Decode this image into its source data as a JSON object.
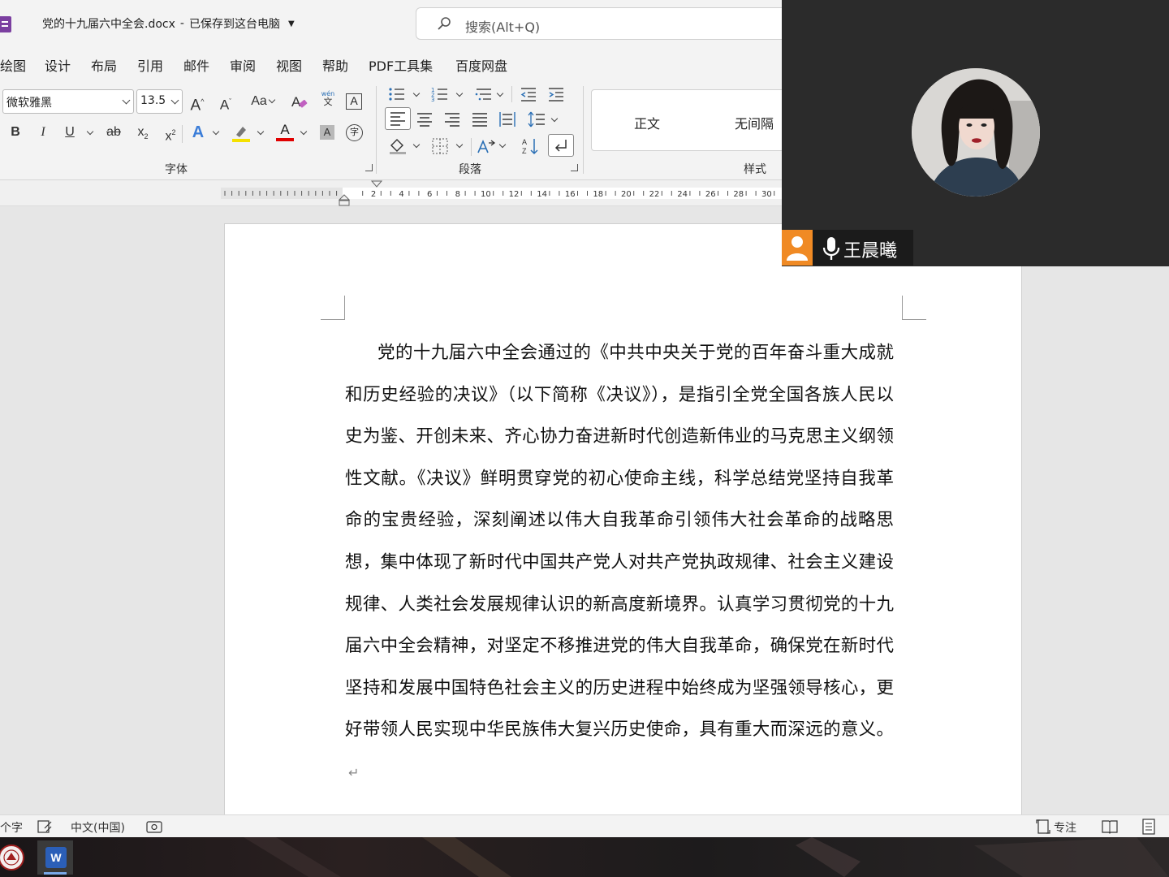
{
  "window": {
    "doc_title": "党的十九届六中全会.docx",
    "separator": "-",
    "save_status": "已保存到这台电脑",
    "search_placeholder": "搜索(Alt+Q)"
  },
  "menu": [
    "绘图",
    "设计",
    "布局",
    "引用",
    "邮件",
    "审阅",
    "视图",
    "帮助",
    "PDF工具集",
    "百度网盘"
  ],
  "ribbon": {
    "font_name": "微软雅黑",
    "font_size": "13.5",
    "grow_font": "A",
    "shrink_font": "A",
    "change_case": "Aa",
    "phonetic_top": "wén",
    "phonetic_bottom": "文",
    "bold": "B",
    "italic": "I",
    "underline": "U",
    "strike": "ab",
    "subscript": "x",
    "subscript_mark": "2",
    "superscript": "x",
    "superscript_mark": "2",
    "text_effect": "A",
    "font_color": "A",
    "char_shading": "A",
    "enclose_char": "字",
    "group_font": "字体",
    "group_paragraph": "段落",
    "group_styles": "样式",
    "style_normal": "正文",
    "style_no_spacing": "无间隔",
    "highlight_color": "#f5e100",
    "font_color_value": "#e00000"
  },
  "ruler": {
    "labels": [
      "2",
      "4",
      "6",
      "8",
      "10",
      "12",
      "14",
      "16",
      "18",
      "20",
      "22",
      "24",
      "26",
      "28",
      "30"
    ]
  },
  "document": {
    "paragraph": "党的十九届六中全会通过的《中共中央关于党的百年奋斗重大成就和历史经验的决议》（以下简称《决议》），是指引全党全国各族人民以史为鉴、开创未来、齐心协力奋进新时代创造新伟业的马克思主义纲领性文献。《决议》鲜明贯穿党的初心使命主线，科学总结党坚持自我革命的宝贵经验，深刻阐述以伟大自我革命引领伟大社会革命的战略思想，集中体现了新时代中国共产党人对共产党执政规律、社会主义建设规律、人类社会发展规律认识的新高度新境界。认真学习贯彻党的十九届六中全会精神，对坚定不移推进党的伟大自我革命，确保党在新时代坚持和发展中国特色社会主义的历史进程中始终成为坚强领导核心，更好带领人民实现中华民族伟大复兴历史使命，具有重大而深远的意义。",
    "paragraph_mark": "↵"
  },
  "status": {
    "word_count": "个字",
    "language": "中文(中国)",
    "focus": "专注"
  },
  "taskbar": {
    "word_letter": "W"
  },
  "video": {
    "participant_name": "王晨曦",
    "accent_color": "#f08a24"
  }
}
